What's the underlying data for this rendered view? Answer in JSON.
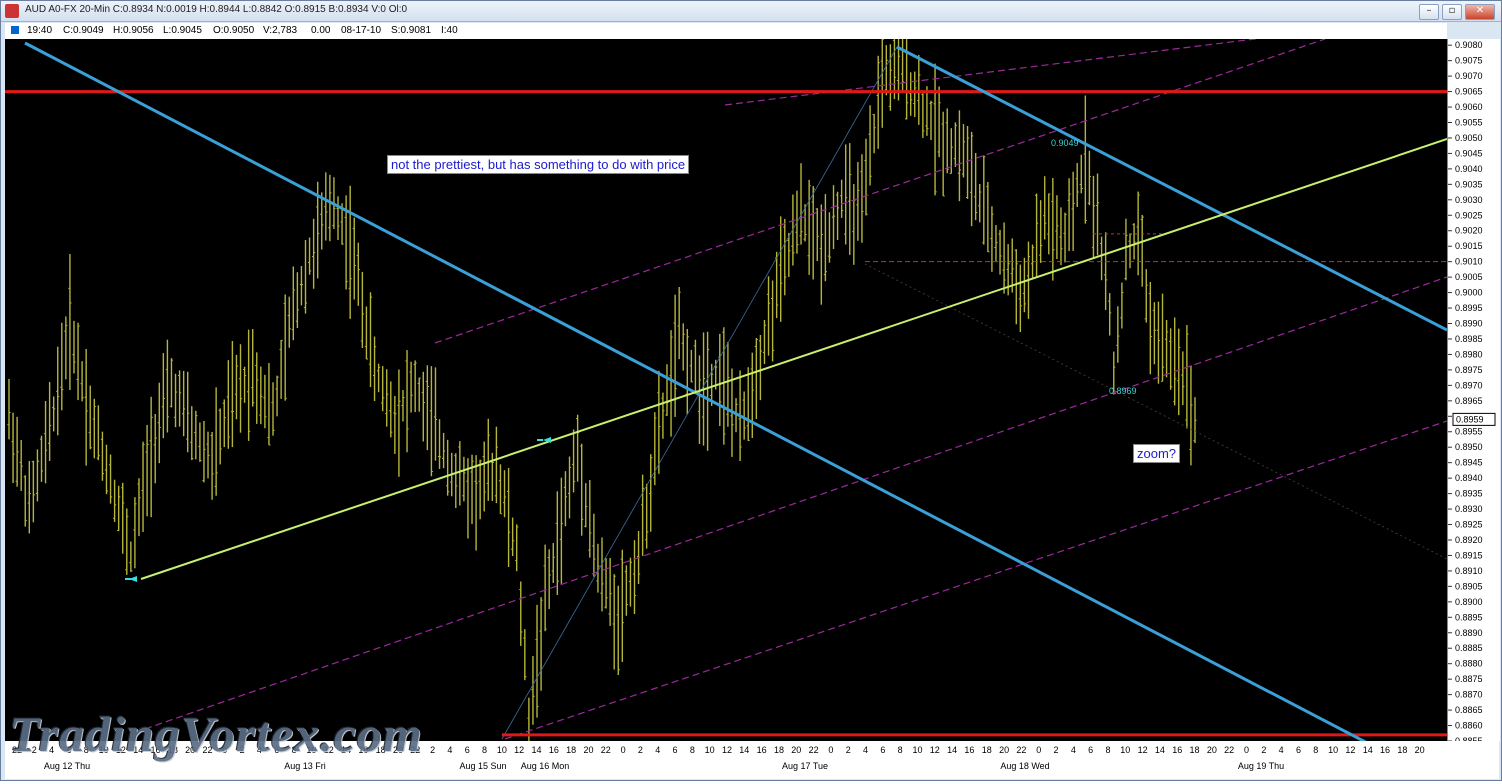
{
  "window": {
    "title": "AUD A0-FX 20-Min C:0.8934 N:0.0019 H:0.8944 L:0.8842 O:0.8915 B:0.8934 V:0 Ol:0",
    "buttons": [
      "–",
      "▫",
      "✕"
    ]
  },
  "infobar": {
    "time": "19:40",
    "close": "C:0.9049",
    "high": "H:0.9056",
    "low": "L:0.9045",
    "open": "O:0.9050",
    "volume": "V:2,783",
    "change": "0.00",
    "date": "08-17-10",
    "s": "S:0.9081",
    "i": "I:40"
  },
  "annotations": {
    "main": "not the prettiest, but has something to do with price",
    "zoom": "zoom?"
  },
  "point_labels": {
    "high": "0.9049",
    "low": "0.8969"
  },
  "current_price": "0.8959",
  "watermark": "TradingVortex.com",
  "colors": {
    "background": "#000000",
    "bars": "#b5b53a",
    "red_line": "#e01818",
    "blue_line": "#3aa0d8",
    "green_line": "#c8f070",
    "channel": "#9b2a9b"
  },
  "chart_data": {
    "type": "bar",
    "instrument": "AUD A0-FX",
    "timeframe": "20-Min",
    "ylim": [
      0.8855,
      0.9082
    ],
    "y_ticks": [
      "0.9080",
      "0.9075",
      "0.9070",
      "0.9065",
      "0.9060",
      "0.9055",
      "0.9050",
      "0.9045",
      "0.9040",
      "0.9035",
      "0.9030",
      "0.9025",
      "0.9020",
      "0.9015",
      "0.9010",
      "0.9005",
      "0.9000",
      "0.8995",
      "0.8990",
      "0.8985",
      "0.8980",
      "0.8975",
      "0.8970",
      "0.8965",
      "0.8960",
      "0.8955",
      "0.8950",
      "0.8945",
      "0.8940",
      "0.8935",
      "0.8930",
      "0.8925",
      "0.8920",
      "0.8915",
      "0.8910",
      "0.8905",
      "0.8900",
      "0.8895",
      "0.8890",
      "0.8885",
      "0.8880",
      "0.8875",
      "0.8870",
      "0.8865",
      "0.8860",
      "0.8855"
    ],
    "x_ticks": [
      "22",
      "2",
      "4",
      "6",
      "8",
      "10",
      "12",
      "14",
      "16",
      "18",
      "20",
      "22",
      "0",
      "2",
      "4",
      "6",
      "8",
      "10",
      "12",
      "14",
      "16",
      "18",
      "20",
      "22",
      "2",
      "4",
      "6",
      "8",
      "10",
      "12",
      "14",
      "16",
      "18",
      "20",
      "22",
      "0",
      "2",
      "4",
      "6",
      "8",
      "10",
      "12",
      "14",
      "16",
      "18",
      "20",
      "22",
      "0",
      "2",
      "4",
      "6",
      "8",
      "10",
      "12",
      "14",
      "16",
      "18",
      "20",
      "22",
      "0",
      "2",
      "4",
      "6",
      "8",
      "10",
      "12",
      "14",
      "16",
      "18",
      "20",
      "22",
      "0",
      "2",
      "4",
      "6",
      "8",
      "10",
      "12",
      "14",
      "16",
      "18",
      "20"
    ],
    "date_labels": [
      "Aug 12 Thu",
      "Aug 13 Fri",
      "Aug 15 Sun",
      "Aug 16 Mon",
      "Aug 17 Tue",
      "Aug 18 Wed",
      "Aug 19 Thu"
    ],
    "price_path": [
      [
        0,
        0.896
      ],
      [
        5,
        0.893
      ],
      [
        10,
        0.8955
      ],
      [
        15,
        0.899
      ],
      [
        20,
        0.896
      ],
      [
        25,
        0.894
      ],
      [
        30,
        0.8915
      ],
      [
        35,
        0.895
      ],
      [
        40,
        0.897
      ],
      [
        45,
        0.8955
      ],
      [
        50,
        0.8945
      ],
      [
        55,
        0.8965
      ],
      [
        60,
        0.8975
      ],
      [
        65,
        0.896
      ],
      [
        70,
        0.8995
      ],
      [
        75,
        0.9015
      ],
      [
        80,
        0.903
      ],
      [
        85,
        0.901
      ],
      [
        90,
        0.8975
      ],
      [
        95,
        0.896
      ],
      [
        100,
        0.897
      ],
      [
        105,
        0.8955
      ],
      [
        110,
        0.894
      ],
      [
        115,
        0.8935
      ],
      [
        120,
        0.8945
      ],
      [
        125,
        0.8915
      ],
      [
        128,
        0.8862
      ],
      [
        132,
        0.89
      ],
      [
        136,
        0.8925
      ],
      [
        140,
        0.895
      ],
      [
        145,
        0.891
      ],
      [
        150,
        0.8895
      ],
      [
        155,
        0.8915
      ],
      [
        160,
        0.8955
      ],
      [
        165,
        0.8985
      ],
      [
        170,
        0.897
      ],
      [
        175,
        0.8975
      ],
      [
        180,
        0.8955
      ],
      [
        185,
        0.898
      ],
      [
        190,
        0.9005
      ],
      [
        195,
        0.9025
      ],
      [
        200,
        0.9015
      ],
      [
        205,
        0.903
      ],
      [
        210,
        0.9025
      ],
      [
        215,
        0.907
      ],
      [
        220,
        0.9072
      ],
      [
        225,
        0.906
      ],
      [
        230,
        0.905
      ],
      [
        235,
        0.9045
      ],
      [
        240,
        0.9025
      ],
      [
        245,
        0.901
      ],
      [
        250,
        0.9
      ],
      [
        255,
        0.9025
      ],
      [
        260,
        0.9015
      ],
      [
        265,
        0.9045
      ],
      [
        270,
        0.9005
      ],
      [
        272,
        0.8975
      ],
      [
        275,
        0.901
      ],
      [
        278,
        0.902
      ],
      [
        281,
        0.899
      ],
      [
        285,
        0.898
      ],
      [
        289,
        0.8975
      ],
      [
        292,
        0.8959
      ]
    ],
    "horizontal_lines": [
      0.9065,
      0.8857,
      0.901
    ],
    "y_marks_horizontal_dotted": [
      0.9019
    ]
  }
}
